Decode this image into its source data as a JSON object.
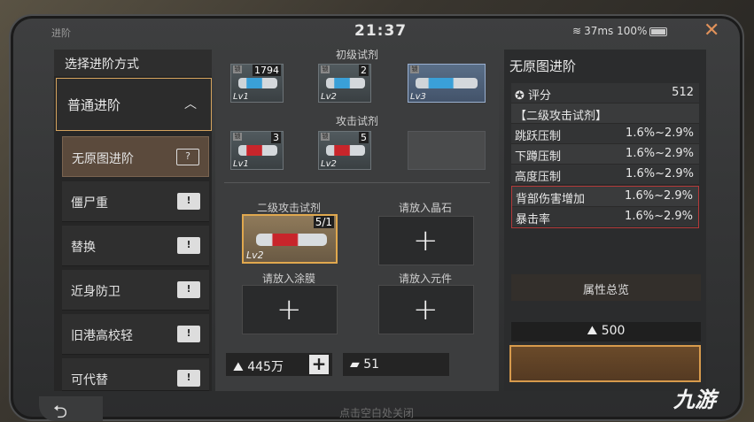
{
  "header": {
    "title": "进阶",
    "clock": "21:37",
    "wifi_icon": "wifi-icon",
    "ping": "37ms",
    "battery": "100%",
    "close_icon": "✕"
  },
  "left": {
    "title": "选择进阶方式",
    "mode": "普通进阶",
    "items": [
      {
        "label": "无原图进阶",
        "icon": "?"
      },
      {
        "label": "僵尸重",
        "icon": "!"
      },
      {
        "label": "替换",
        "icon": "!"
      },
      {
        "label": "近身防卫",
        "icon": "!"
      },
      {
        "label": "旧港高校轻",
        "icon": "!"
      },
      {
        "label": "可代替",
        "icon": "!"
      }
    ]
  },
  "middle": {
    "group1_label": "初级试剂",
    "group1": [
      {
        "count": "1794",
        "lv": "Lv1"
      },
      {
        "count": "2",
        "lv": "Lv2"
      },
      {
        "count": "",
        "lv": "Lv3"
      }
    ],
    "group2_label": "攻击试剂",
    "group2": [
      {
        "count": "3",
        "lv": "Lv1"
      },
      {
        "count": "5",
        "lv": "Lv2"
      }
    ],
    "slot_main_label": "二级攻击试剂",
    "slot_main_count": "5/1",
    "slot_main_lv": "Lv2",
    "slot_stone_label": "请放入晶石",
    "slot_coating_label": "请放入涂膜",
    "slot_part_label": "请放入元件",
    "coins": "445万",
    "tickets": "51"
  },
  "right": {
    "title": "无原图进阶",
    "score_label": "评分",
    "score": "512",
    "item_name": "【二级攻击试剂】",
    "stats": [
      {
        "name": "跳跃压制",
        "val": "1.6%~2.9%"
      },
      {
        "name": "下蹲压制",
        "val": "1.6%~2.9%"
      },
      {
        "name": "高度压制",
        "val": "1.6%~2.9%"
      },
      {
        "name": "背部伤害增加",
        "val": "1.6%~2.9%"
      },
      {
        "name": "暴击率",
        "val": "1.6%~2.9%"
      }
    ],
    "overview": "属性总览",
    "cost": "500"
  },
  "footer": {
    "back_icon": "⮌",
    "hint": "点击空白处关闭"
  },
  "watermark": "九游"
}
